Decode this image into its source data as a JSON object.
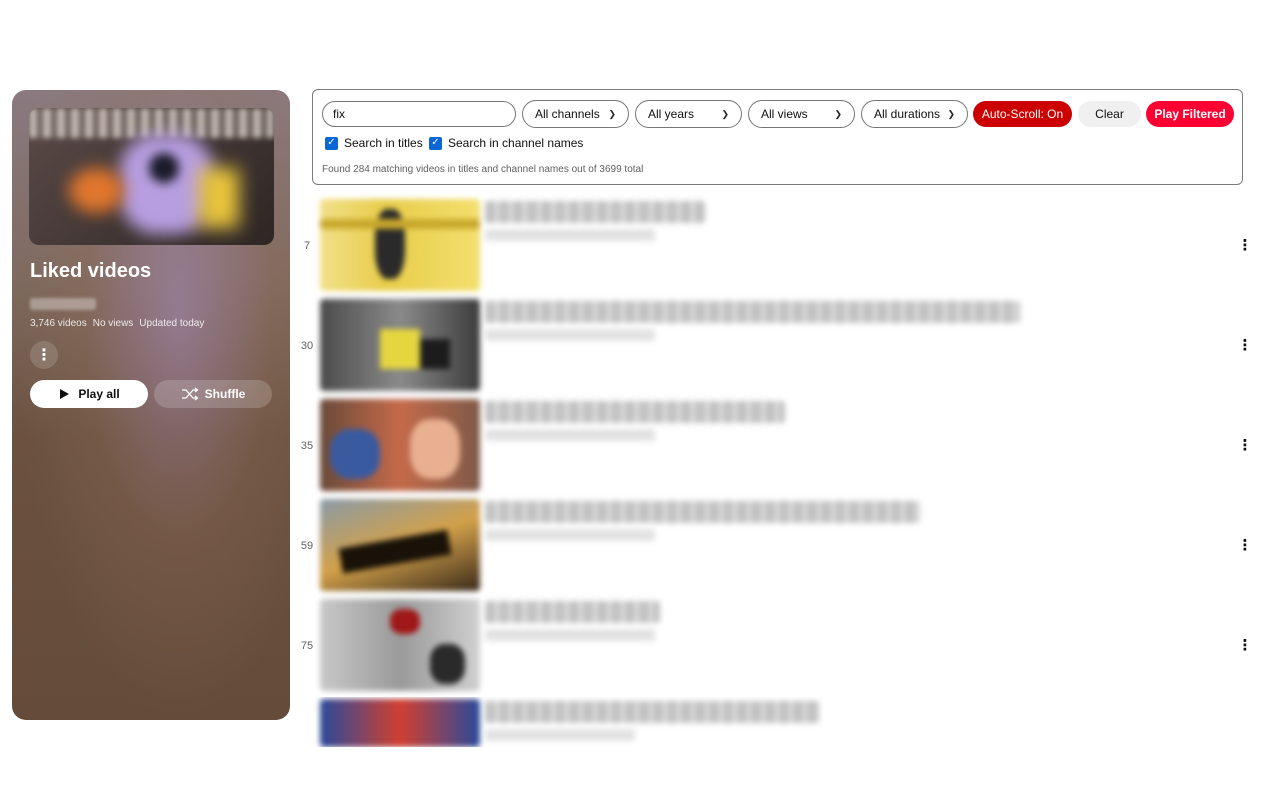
{
  "playlist": {
    "title": "Liked videos",
    "video_count": "3,746 videos",
    "views": "No views",
    "updated": "Updated today",
    "play_all_label": "Play all",
    "shuffle_label": "Shuffle"
  },
  "filters": {
    "search_value": "fix",
    "channel_select": "All channels",
    "year_select": "All years",
    "views_select": "All views",
    "duration_select": "All durations",
    "auto_scroll_label": "Auto-Scroll: On",
    "clear_label": "Clear",
    "play_filtered_label": "Play Filtered",
    "search_titles_label": "Search in titles",
    "search_titles_checked": true,
    "search_channels_label": "Search in channel names",
    "search_channels_checked": true,
    "found_text": "Found 284 matching videos in titles and channel names out of 3699 total",
    "colors": {
      "auto_scroll": "#cc0000",
      "play_filtered": "#ff0033",
      "checkbox": "#0b67d6"
    }
  },
  "videos": [
    {
      "index": "7"
    },
    {
      "index": "30"
    },
    {
      "index": "35"
    },
    {
      "index": "59"
    },
    {
      "index": "75"
    },
    {
      "index": ""
    }
  ]
}
